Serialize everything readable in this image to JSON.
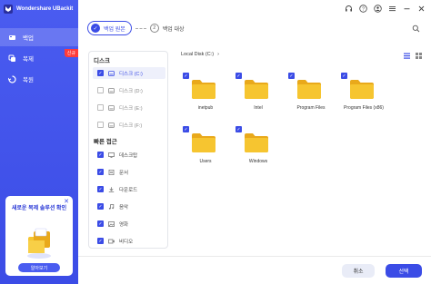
{
  "app": {
    "title": "Wondershare UBackit"
  },
  "sidebar": {
    "items": [
      {
        "label": "백업",
        "icon": "backup-icon"
      },
      {
        "label": "복제",
        "icon": "clone-icon",
        "badge": "신규"
      },
      {
        "label": "복원",
        "icon": "restore-icon"
      }
    ],
    "promo": {
      "text": "새로운 복제 솔루션 확인",
      "button": "알아보기"
    }
  },
  "steps": {
    "step1": "백업 원본",
    "step2_num": "2",
    "step2": "백업 대상"
  },
  "tree": {
    "disk_header": "디스크",
    "disks": [
      {
        "label": "디스크 (C:)",
        "checked": true
      },
      {
        "label": "디스크 (D:)",
        "checked": false
      },
      {
        "label": "디스크 (E:)",
        "checked": false
      },
      {
        "label": "디스크 (F:)",
        "checked": false
      }
    ],
    "quick_header": "빠른 접근",
    "quick": [
      {
        "label": "데스크탑",
        "icon": "desktop-icon"
      },
      {
        "label": "문서",
        "icon": "document-icon"
      },
      {
        "label": "다운로드",
        "icon": "download-icon"
      },
      {
        "label": "음악",
        "icon": "music-icon"
      },
      {
        "label": "영화",
        "icon": "picture-icon"
      },
      {
        "label": "비디오",
        "icon": "video-icon"
      }
    ]
  },
  "main": {
    "path": "Local Disk (C:)",
    "folders": [
      "inetpub",
      "Intel",
      "Program Files",
      "Program Files (x86)",
      "Users",
      "Windows"
    ]
  },
  "footer": {
    "cancel": "취소",
    "ok": "선택"
  },
  "colors": {
    "accent": "#3b4ce6",
    "folder": "#f6c530",
    "folder_dark": "#e9a91b",
    "badge": "#ff3b3b"
  }
}
